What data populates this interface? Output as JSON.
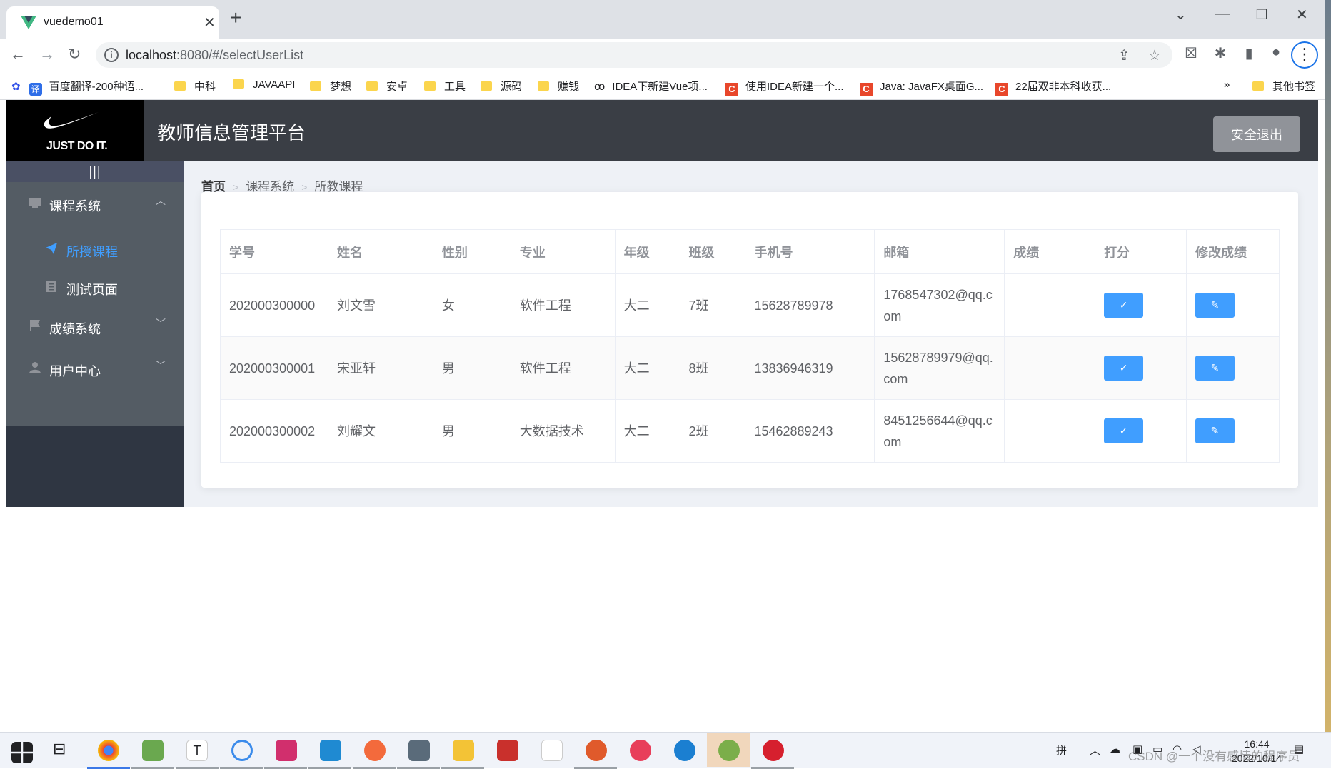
{
  "browser": {
    "tab_title": "vuedemo01",
    "url_host": "localhost",
    "url_rest": ":8080/#/selectUserList",
    "bookmarks": [
      {
        "label": "百度翻译-200种语...",
        "kind": "baidu"
      },
      {
        "label": "中科",
        "kind": "folder"
      },
      {
        "label": "JAVAAPI",
        "kind": "folder"
      },
      {
        "label": "梦想",
        "kind": "folder"
      },
      {
        "label": "安卓",
        "kind": "folder"
      },
      {
        "label": "工具",
        "kind": "folder"
      },
      {
        "label": "源码",
        "kind": "folder"
      },
      {
        "label": "赚钱",
        "kind": "folder"
      },
      {
        "label": "IDEA下新建Vue项...",
        "kind": "link"
      },
      {
        "label": "使用IDEA新建一个...",
        "kind": "csdn"
      },
      {
        "label": "Java: JavaFX桌面G...",
        "kind": "csdn"
      },
      {
        "label": "22届双非本科收获...",
        "kind": "csdn"
      }
    ],
    "bookmarks_more": "»",
    "other_bookmarks": "其他书签"
  },
  "app": {
    "logo_slogan": "JUST DO IT.",
    "title": "教师信息管理平台",
    "logout_label": "安全退出",
    "collapse_label": "|||",
    "menu": [
      {
        "label": "课程系统",
        "icon": "monitor-icon",
        "expanded": true,
        "children": [
          {
            "label": "所授课程",
            "icon": "send-icon",
            "active": true
          },
          {
            "label": "测试页面",
            "icon": "document-icon",
            "active": false
          }
        ]
      },
      {
        "label": "成绩系统",
        "icon": "flag-icon",
        "expanded": false
      },
      {
        "label": "用户中心",
        "icon": "user-icon",
        "expanded": false
      }
    ],
    "breadcrumb": [
      "首页",
      "课程系统",
      "所教课程"
    ],
    "table": {
      "columns": [
        "学号",
        "姓名",
        "性别",
        "专业",
        "年级",
        "班级",
        "手机号",
        "邮箱",
        "成绩",
        "打分",
        "修改成绩"
      ],
      "rows": [
        {
          "id": "202000300000",
          "name": "刘文雪",
          "gender": "女",
          "major": "软件工程",
          "grade": "大二",
          "class": "7班",
          "phone": "15628789978",
          "email": "1768547302@qq.com",
          "score": ""
        },
        {
          "id": "202000300001",
          "name": "宋亚轩",
          "gender": "男",
          "major": "软件工程",
          "grade": "大二",
          "class": "8班",
          "phone": "13836946319",
          "email": "15628789979@qq.com",
          "score": ""
        },
        {
          "id": "202000300002",
          "name": "刘耀文",
          "gender": "男",
          "major": "大数据技术",
          "grade": "大二",
          "class": "2班",
          "phone": "15462889243",
          "email": "8451256644@qq.com",
          "score": ""
        }
      ],
      "grade_button_icon": "✓",
      "edit_button_icon": "✎"
    }
  },
  "taskbar": {
    "ime": "拼",
    "time": "16:44",
    "date": "2022/10/14",
    "watermark": "CSDN @一个没有感情的程序员"
  },
  "colors": {
    "header": "#3a3e45",
    "sidebar": "#545c64",
    "accent": "#409eff",
    "logout": "#909399"
  }
}
